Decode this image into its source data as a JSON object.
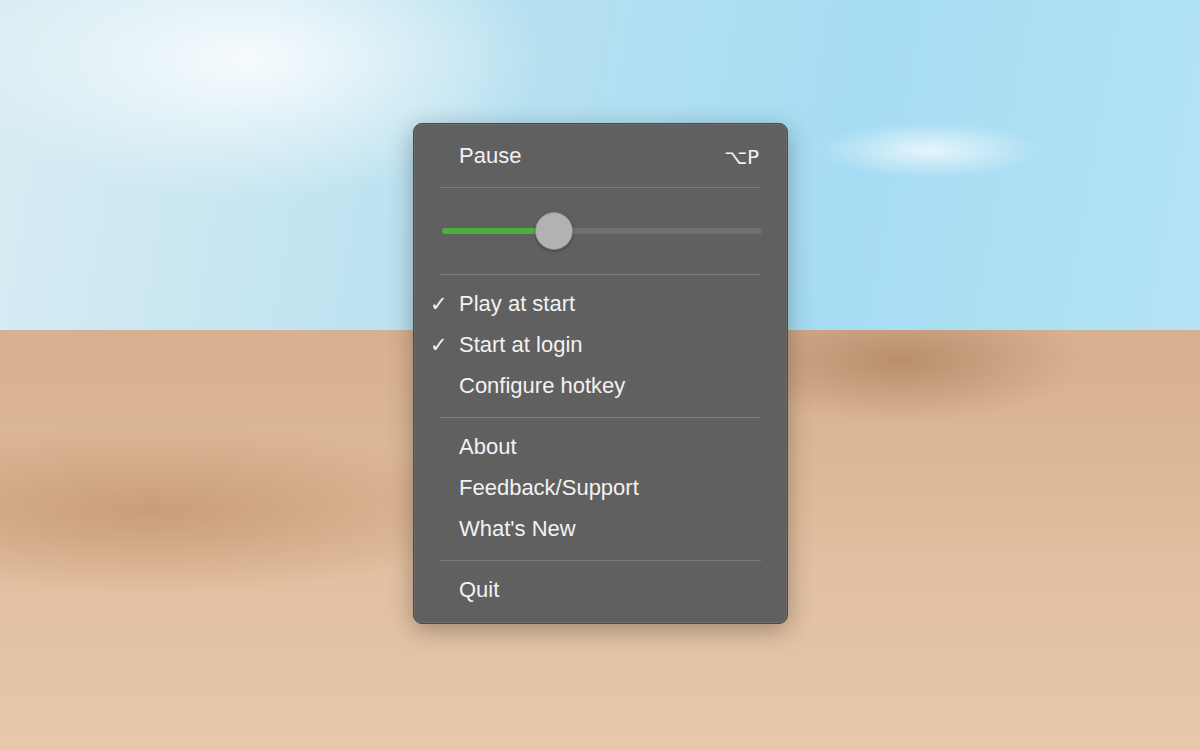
{
  "menu": {
    "items": [
      {
        "kind": "action",
        "label": "Pause",
        "shortcut": "⌥P"
      },
      {
        "kind": "separator"
      },
      {
        "kind": "slider",
        "level": 0.35
      },
      {
        "kind": "separator"
      },
      {
        "kind": "toggle",
        "label": "Play at start",
        "checked": true,
        "mark": "✓"
      },
      {
        "kind": "toggle",
        "label": "Start at login",
        "checked": true,
        "mark": "✓"
      },
      {
        "kind": "action",
        "label": "Configure hotkey"
      },
      {
        "kind": "separator"
      },
      {
        "kind": "action",
        "label": "About"
      },
      {
        "kind": "action",
        "label": "Feedback/Support"
      },
      {
        "kind": "action",
        "label": "What's New"
      },
      {
        "kind": "separator"
      },
      {
        "kind": "action",
        "label": "Quit"
      }
    ]
  }
}
